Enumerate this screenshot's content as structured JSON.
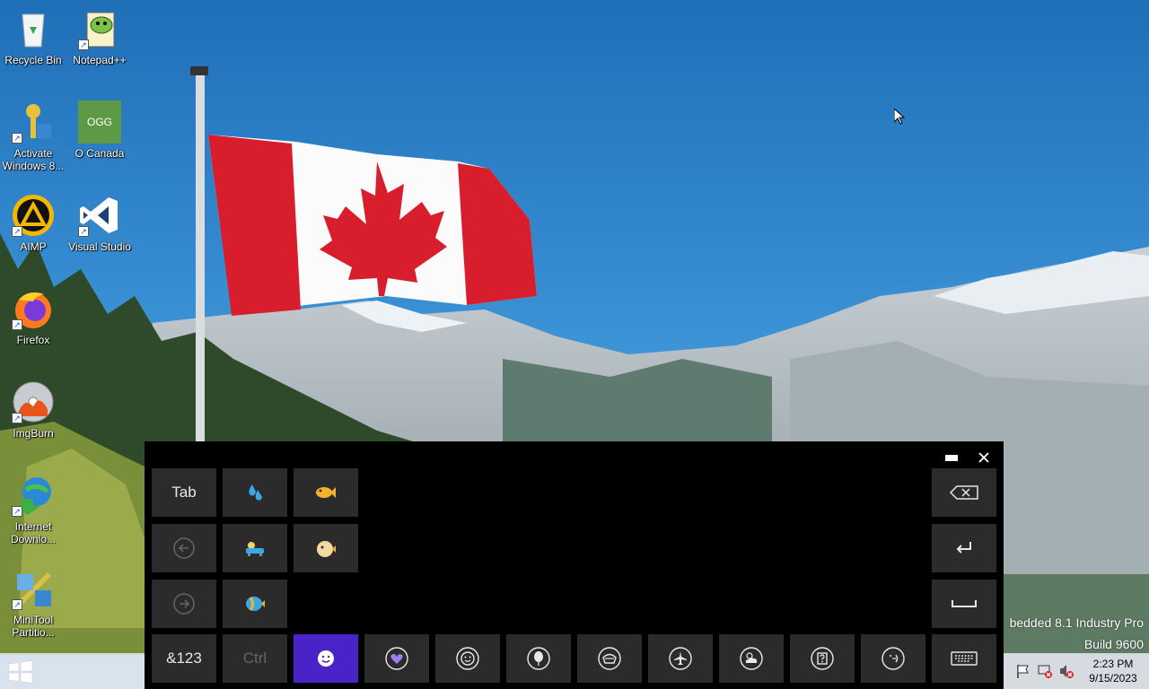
{
  "desktop": {
    "icons": [
      {
        "label": "Recycle Bin",
        "icon": "recycle-bin-icon"
      },
      {
        "label": "Notepad++",
        "icon": "notepad-plus-plus-icon"
      },
      {
        "label": "Activate Windows 8...",
        "icon": "activate-windows-icon"
      },
      {
        "label": "O Canada",
        "icon": "ogg-file-icon",
        "badge": "OGG"
      },
      {
        "label": "AIMP",
        "icon": "aimp-icon"
      },
      {
        "label": "Visual Studio",
        "icon": "visual-studio-icon"
      },
      {
        "label": "Firefox",
        "icon": "firefox-icon"
      },
      {
        "label": "ImgBurn",
        "icon": "imgburn-icon"
      },
      {
        "label": "Internet Downlo...",
        "icon": "internet-download-manager-icon"
      },
      {
        "label": "MiniTool Partitio...",
        "icon": "minitool-partition-icon"
      }
    ],
    "watermark_line1": "bedded 8.1 Industry Pro",
    "watermark_line2": "Build 9600"
  },
  "keyboard": {
    "row1": {
      "tab": "Tab",
      "emoji1": "sweat-droplets-icon",
      "emoji2": "fish-icon"
    },
    "row2": {
      "emoji1": "bathtub-icon",
      "emoji2": "blowfish-icon"
    },
    "row3": {
      "emoji1": "tropical-fish-icon"
    },
    "bottom": {
      "numsym": "&123",
      "ctrl": "Ctrl"
    },
    "categories": [
      "smiley-icon",
      "heart-icon",
      "smiley-icon",
      "balloon-icon",
      "food-icon",
      "airplane-icon",
      "weather-icon",
      "symbols-icon",
      "text-emoticon-icon"
    ],
    "accent": "#4a23c8"
  },
  "taskbar": {
    "time": "2:23 PM",
    "date": "9/15/2023"
  }
}
